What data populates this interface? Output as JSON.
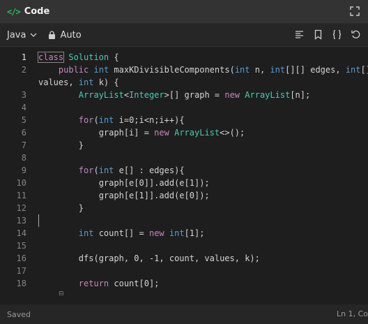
{
  "titlebar": {
    "code_icon": "</>",
    "title": "Code"
  },
  "toolbar": {
    "language": "Java",
    "mode": "Auto"
  },
  "editor": {
    "lines": [
      {
        "n": "1",
        "t": "class Solution {"
      },
      {
        "n": "2",
        "t": "    public int maxKDivisibleComponents(int n, int[][] edges, int[]"
      },
      {
        "n": "",
        "t": "values, int k) {"
      },
      {
        "n": "3",
        "t": "        ArrayList<Integer>[] graph = new ArrayList[n];"
      },
      {
        "n": "4",
        "t": ""
      },
      {
        "n": "5",
        "t": "        for(int i=0;i<n;i++){"
      },
      {
        "n": "6",
        "t": "            graph[i] = new ArrayList<>();"
      },
      {
        "n": "7",
        "t": "        }"
      },
      {
        "n": "8",
        "t": ""
      },
      {
        "n": "9",
        "t": "        for(int e[] : edges){"
      },
      {
        "n": "10",
        "t": "            graph[e[0]].add(e[1]);"
      },
      {
        "n": "11",
        "t": "            graph[e[1]].add(e[0]);"
      },
      {
        "n": "12",
        "t": "        }"
      },
      {
        "n": "13",
        "t": ""
      },
      {
        "n": "14",
        "t": "        int count[] = new int[1];"
      },
      {
        "n": "15",
        "t": ""
      },
      {
        "n": "16",
        "t": "        dfs(graph, 0, -1, count, values, k);"
      },
      {
        "n": "17",
        "t": ""
      },
      {
        "n": "18",
        "t": "        return count[0];"
      }
    ]
  },
  "status": {
    "saved": "Saved",
    "position": "Ln 1, Co"
  }
}
